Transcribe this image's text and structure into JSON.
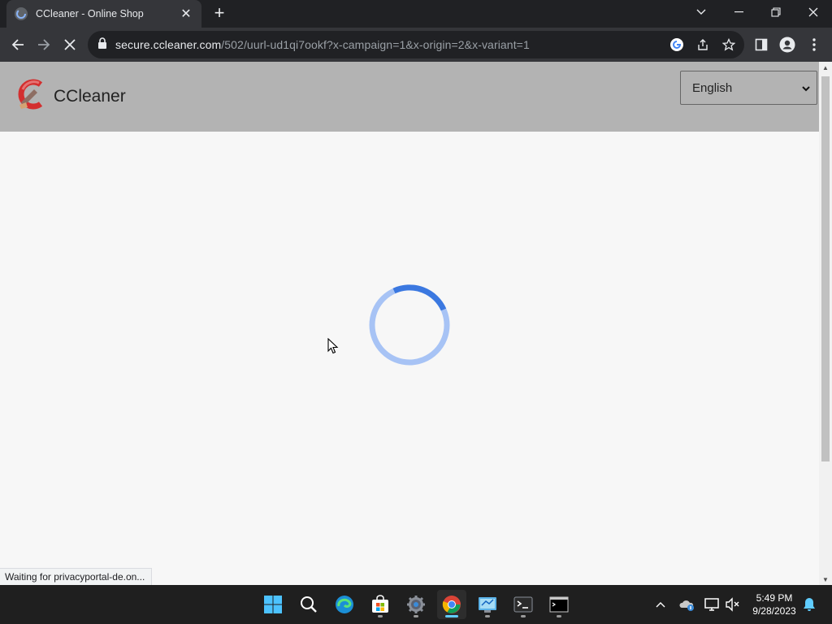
{
  "browser": {
    "tab": {
      "title": "CCleaner - Online Shop"
    },
    "url": {
      "host": "secure.ccleaner.com",
      "path": "/502/uurl-ud1qi7ookf?x-campaign=1&x-origin=2&x-variant=1"
    },
    "status_text": "Waiting for privacyportal-de.on..."
  },
  "page": {
    "logo_text": "CCleaner",
    "language_select": {
      "value": "English"
    },
    "spinner": {
      "state": "loading"
    }
  },
  "taskbar": {
    "apps": [
      "start-icon",
      "search-icon",
      "edge-icon",
      "store-icon",
      "settings-icon",
      "chrome-icon",
      "control-panel-icon",
      "terminal-icon",
      "cmd-icon"
    ],
    "clock": {
      "time": "5:49 PM",
      "date": "9/28/2023"
    }
  },
  "colors": {
    "header_bg": "#b3b3b3",
    "page_bg": "#f7f7f7",
    "spinner_track": "#a7c3f5",
    "spinner_arc": "#3b78e0"
  }
}
